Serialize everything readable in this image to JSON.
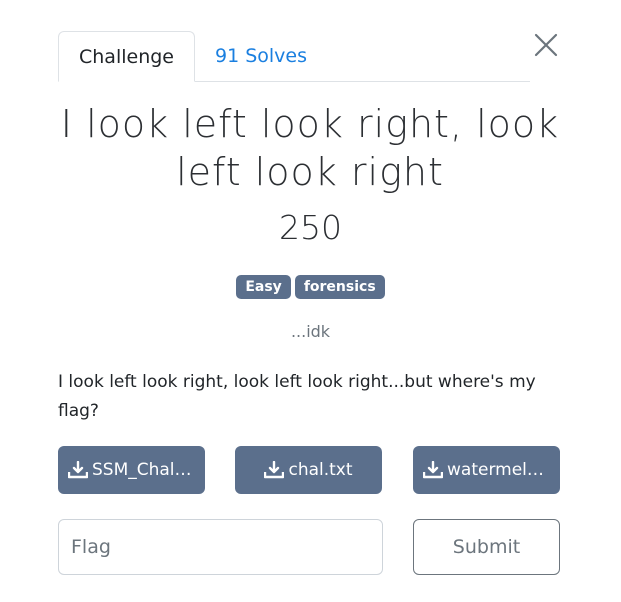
{
  "tabs": [
    {
      "label": "Challenge",
      "active": true
    },
    {
      "label": "91 Solves",
      "active": false
    }
  ],
  "challenge": {
    "title": "I look left look right, look left look right",
    "points": "250",
    "tags": [
      "Easy",
      "forensics"
    ],
    "author": "...idk",
    "description": "I look left look right, look left look right...but where's my flag?"
  },
  "files": [
    {
      "name": "SSM_Chal....",
      "icon": "download-icon"
    },
    {
      "name": "chal.txt",
      "icon": "download-icon"
    },
    {
      "name": "watermelo...",
      "icon": "download-icon"
    }
  ],
  "form": {
    "flag_placeholder": "Flag",
    "submit_label": "Submit"
  },
  "colors": {
    "tag_bg": "#5b6f8c",
    "link": "#1a7fe0"
  }
}
